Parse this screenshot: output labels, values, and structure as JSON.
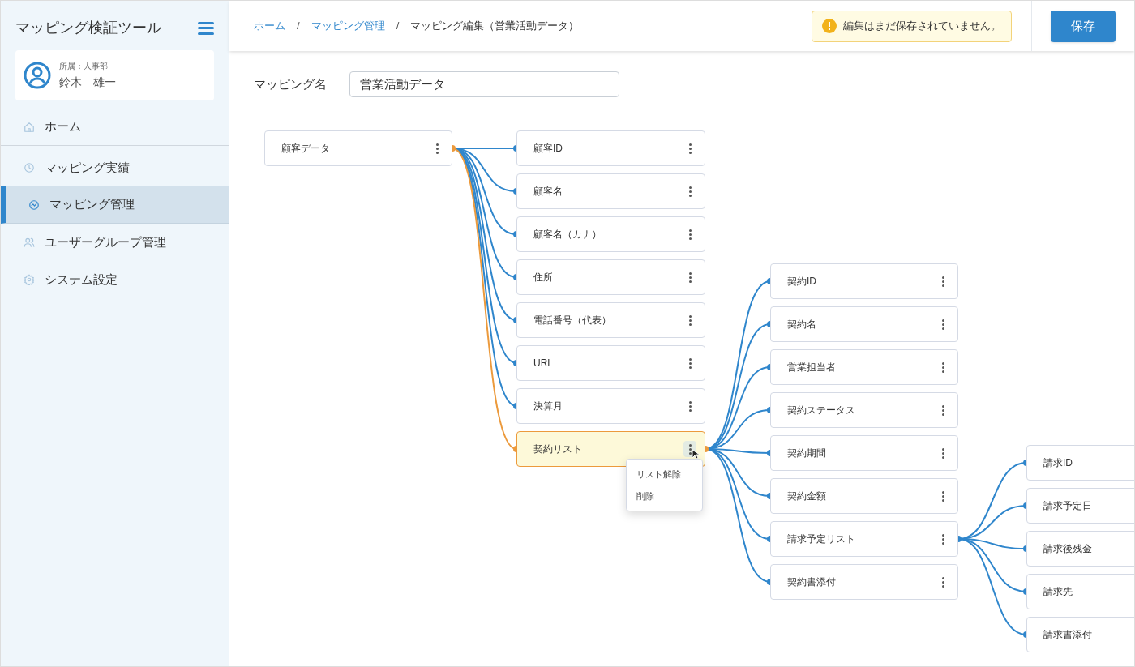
{
  "app": {
    "title": "マッピング検証ツール"
  },
  "user": {
    "department": "所属：人事部",
    "name": "鈴木　雄一"
  },
  "nav": [
    {
      "label": "ホーム",
      "kind": "home",
      "selected": false
    },
    {
      "label": "マッピング実績",
      "kind": "history",
      "selected": false
    },
    {
      "label": "マッピング管理",
      "kind": "chart",
      "selected": true
    },
    {
      "label": "ユーザーグループ管理",
      "kind": "users",
      "selected": false
    },
    {
      "label": "システム設定",
      "kind": "settings",
      "selected": false
    }
  ],
  "breadcrumb_separator": "/",
  "breadcrumbs": [
    {
      "label": "ホーム",
      "link": true
    },
    {
      "label": "マッピング管理",
      "link": true
    },
    {
      "label": "マッピング編集（営業活動データ）",
      "link": false
    }
  ],
  "notice": "編集はまだ保存されていません。",
  "save_button": "保存",
  "mapping_name": {
    "label": "マッピング名",
    "value": "営業活動データ"
  },
  "tree": {
    "label": "顧客データ",
    "selected": false,
    "children": [
      {
        "label": "顧客ID",
        "selected": false
      },
      {
        "label": "顧客名",
        "selected": false
      },
      {
        "label": "顧客名（カナ）",
        "selected": false
      },
      {
        "label": "住所",
        "selected": false
      },
      {
        "label": "電話番号（代表）",
        "selected": false
      },
      {
        "label": "URL",
        "selected": false
      },
      {
        "label": "決算月",
        "selected": false
      },
      {
        "label": "契約リスト",
        "selected": true,
        "menu": {
          "items": [
            "リスト解除",
            "削除"
          ]
        },
        "children": [
          {
            "label": "契約ID",
            "selected": false
          },
          {
            "label": "契約名",
            "selected": false
          },
          {
            "label": "営業担当者",
            "selected": false
          },
          {
            "label": "契約ステータス",
            "selected": false
          },
          {
            "label": "契約期間",
            "selected": false
          },
          {
            "label": "契約金額",
            "selected": false
          },
          {
            "label": "請求予定リスト",
            "selected": false,
            "children": [
              {
                "label": "請求ID",
                "selected": false
              },
              {
                "label": "請求予定日",
                "selected": false
              },
              {
                "label": "請求後残金",
                "selected": false
              },
              {
                "label": "請求先",
                "selected": false
              },
              {
                "label": "請求書添付",
                "selected": false
              }
            ]
          },
          {
            "label": "契約書添付",
            "selected": false
          }
        ]
      }
    ]
  }
}
